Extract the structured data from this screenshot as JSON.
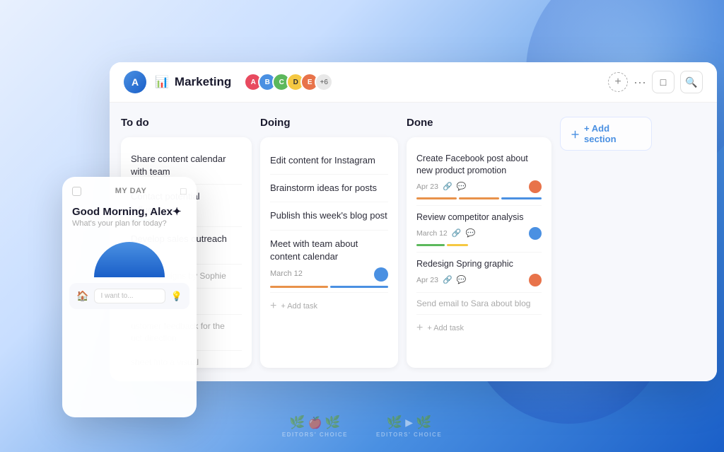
{
  "background": {
    "gradient": "linear-gradient(135deg, #e8f0fe 0%, #c8deff 30%, #4a90e2 70%, #1a5fc8 100%)"
  },
  "board": {
    "title": "Marketing",
    "avatar_initial": "A",
    "member_count": "+6",
    "columns": {
      "todo": {
        "header": "To do",
        "tasks": [
          {
            "text": "Share content calendar with team",
            "highlighted": false
          },
          {
            "text": "Contact potential influencers",
            "highlighted": true,
            "underline": true
          },
          {
            "text": "Develop sales outreach plan",
            "highlighted": false
          }
        ]
      },
      "doing": {
        "header": "Doing",
        "tasks": [
          {
            "text": "Edit content for Instagram",
            "has_meta": false
          },
          {
            "text": "Brainstorm ideas for posts",
            "has_meta": false
          },
          {
            "text": "Publish this week's blog post",
            "has_meta": false
          },
          {
            "text": "Meet with team about content calendar",
            "has_meta": true,
            "date": "March 12",
            "avatar_color": "#4a90e2"
          }
        ]
      },
      "done": {
        "header": "Done",
        "tasks": [
          {
            "text": "Create Facebook post about new product promotion",
            "date": "Apr 23",
            "avatar_color": "#e8734a",
            "progress": [
              "orange",
              "orange",
              "blue"
            ]
          },
          {
            "text": "Review competitor analysis",
            "date": "March 12",
            "avatar_color": "#4a90e2",
            "progress": [
              "green",
              "yellow"
            ]
          },
          {
            "text": "Redesign Spring graphic",
            "date": "Apr 23",
            "avatar_color": "#e8734a",
            "progress": [
              "blue"
            ]
          },
          {
            "text": "Send email to Sara about blog",
            "date": "",
            "avatar_color": "",
            "progress": []
          }
        ]
      }
    },
    "add_section_label": "+ Add section",
    "add_task_label": "+ Add task"
  },
  "my_day": {
    "header": "MY DAY",
    "greeting": "Good Morning, Alex✦",
    "plan_text": "What's your plan for today?",
    "input_placeholder": "I want to...",
    "half_circle_colors": [
      "#4a90e2",
      "#1a5fc8"
    ]
  },
  "footer": {
    "badges": [
      {
        "label": "EDITORS' CHOICE",
        "icons": [
          "🌿",
          "🍎",
          "🌿"
        ]
      },
      {
        "label": "EDITORS' CHOICE",
        "icons": [
          "🌿",
          "▶",
          "🌿"
        ]
      }
    ]
  },
  "header_buttons": {
    "square": "□",
    "search": "🔍",
    "add": "+",
    "more": "···"
  },
  "member_avatars": [
    {
      "color": "#e84a5f",
      "initial": "A"
    },
    {
      "color": "#4a90e2",
      "initial": "B"
    },
    {
      "color": "#5cb85c",
      "initial": "C"
    },
    {
      "color": "#f5c842",
      "initial": "D"
    },
    {
      "color": "#e8734a",
      "initial": "E"
    }
  ]
}
